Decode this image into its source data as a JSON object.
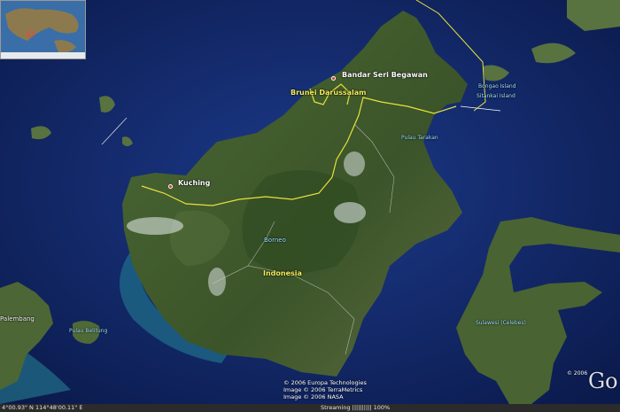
{
  "map": {
    "labels": {
      "bandar": "Bandar Seri Begawan",
      "brunei": "Brunei Darussalam",
      "kuching": "Kuching",
      "borneo": "Borneo",
      "indonesia": "Indonesia",
      "tarakan": "Pulau Tarakan",
      "bongao": "Bongao Island",
      "sitankai": "Sitankai Island",
      "palembang": "Palembang",
      "belitung": "Pulau Belitung",
      "sulawesi": "Sulawesi (Celebes)"
    },
    "credits": {
      "line1": "© 2006 Europa Technologies",
      "line2": "Image © 2006 TerraMetrics",
      "line3": "Image © 2006 NASA"
    },
    "logo_partial": "Go",
    "copyright_small": "© 2006"
  },
  "status": {
    "coords": "4°00.93\"  N  114°48'00.11\" E",
    "streaming": "Streaming |||||||||| 100%"
  },
  "colors": {
    "ocean": "#0d1f55",
    "land": "#3e5a2c",
    "border": "#e8e23a",
    "road": "#c9c9c9"
  }
}
